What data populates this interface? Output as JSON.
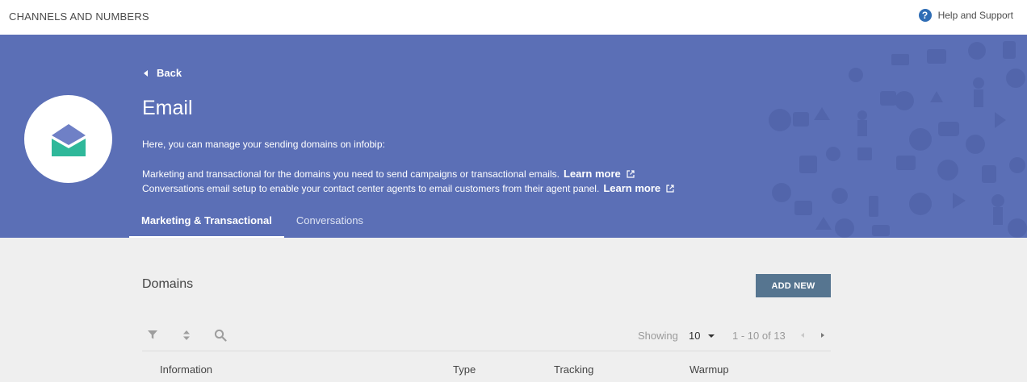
{
  "topbar": {
    "title": "CHANNELS AND NUMBERS",
    "help_label": "Help and Support"
  },
  "hero": {
    "back_label": "Back",
    "title": "Email",
    "intro": "Here, you can manage your sending domains on infobip:",
    "line1": "Marketing and transactional for the domains you need to send campaigns or transactional emails.",
    "line2": "Conversations email setup to enable your contact center agents to email customers from their agent panel.",
    "learn_more": "Learn more",
    "colors": {
      "background": "#5b6fb6",
      "envelope_flap": "#6f80c6",
      "envelope_body": "#2fb89a"
    }
  },
  "tabs": [
    {
      "label": "Marketing & Transactional",
      "active": true
    },
    {
      "label": "Conversations",
      "active": false
    }
  ],
  "domains": {
    "title": "Domains",
    "add_button": "ADD NEW",
    "toolbar": {
      "icons": [
        "filter-icon",
        "sort-icon",
        "search-icon"
      ]
    },
    "pagination": {
      "showing_label": "Showing",
      "page_size": "10",
      "range": "1 - 10 of 13"
    },
    "columns": [
      "Information",
      "Type",
      "Tracking",
      "Warmup"
    ]
  }
}
